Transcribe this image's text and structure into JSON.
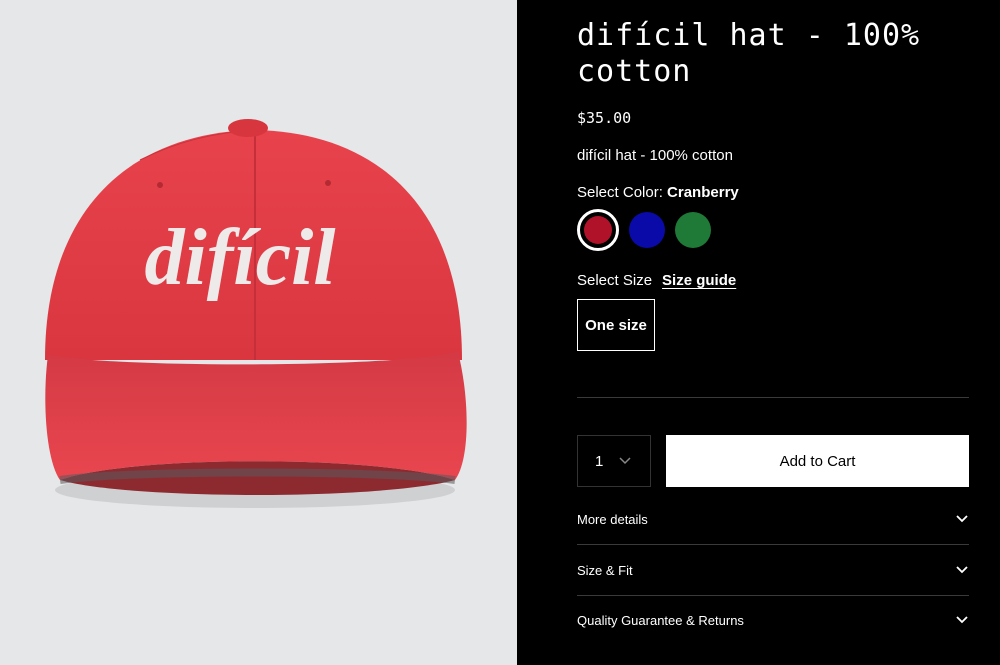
{
  "product": {
    "title": "difícil hat - 100% cotton",
    "price": "$35.00",
    "subtitle": "difícil hat - 100% cotton",
    "hat_text": "difícil"
  },
  "color": {
    "label": "Select Color:",
    "selected": "Cranberry",
    "options": [
      {
        "name": "Cranberry",
        "hex": "#b0122a"
      },
      {
        "name": "Blue",
        "hex": "#0a0aa8"
      },
      {
        "name": "Green",
        "hex": "#1f7a38"
      }
    ]
  },
  "size": {
    "label": "Select Size",
    "guide": "Size guide",
    "option": "One size"
  },
  "cart": {
    "quantity": "1",
    "add_label": "Add to Cart"
  },
  "accordion": [
    {
      "label": "More details"
    },
    {
      "label": "Size & Fit"
    },
    {
      "label": "Quality Guarantee & Returns"
    }
  ],
  "colors": {
    "background": "#000000",
    "image_bg": "#e6e7e9",
    "hat": "#e23a44",
    "button_bg": "#ffffff"
  }
}
